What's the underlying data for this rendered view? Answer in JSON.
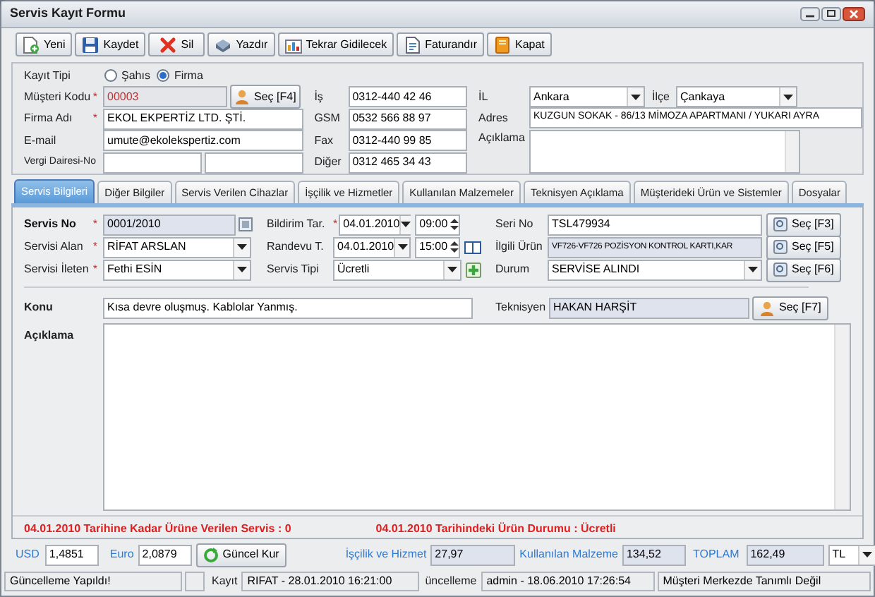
{
  "window": {
    "title": "Servis Kayıt Formu"
  },
  "toolbar": [
    {
      "kind": "new",
      "label": "Yeni"
    },
    {
      "kind": "save",
      "label": "Kaydet"
    },
    {
      "kind": "delete",
      "label": "Sil"
    },
    {
      "kind": "print",
      "label": "Yazdır"
    },
    {
      "kind": "repeat",
      "label": "Tekrar Gidilecek"
    },
    {
      "kind": "invoice",
      "label": "Faturandır"
    },
    {
      "kind": "close",
      "label": "Kapat"
    }
  ],
  "customer": {
    "record_type": {
      "label": "Kayıt Tipi",
      "options": [
        {
          "label": "Şahıs",
          "selected": false
        },
        {
          "label": "Firma",
          "selected": true
        }
      ]
    },
    "customer_code": {
      "label": "Müşteri Kodu",
      "required_mark": "*",
      "value": "00003",
      "button": "Seç [F4]"
    },
    "company": {
      "label": "Firma Adı",
      "required_mark": "*",
      "value": "EKOL EKPERTİZ LTD. ŞTİ."
    },
    "email": {
      "label": "E-mail",
      "value": "umute@ekolekspertiz.com"
    },
    "tax": {
      "label": "Vergi Dairesi-No"
    },
    "phones": [
      {
        "label": "İş",
        "value": "0312-440 42 46"
      },
      {
        "label": "GSM",
        "value": "0532 566 88 97"
      },
      {
        "label": "Fax",
        "value": "0312-440 99 85"
      },
      {
        "label": "Diğer",
        "value": "0312 465 34 43"
      }
    ],
    "city": {
      "label": "İL",
      "value": "Ankara"
    },
    "district": {
      "label": "İlçe",
      "value": "Çankaya"
    },
    "address": {
      "label": "Adres",
      "value": "KUZGUN SOKAK - 86/13  MİMOZA APARTMANI / YUKARI AYRA"
    },
    "note": {
      "label": "Açıklama"
    }
  },
  "tabs": [
    {
      "label": "Servis Bilgileri",
      "selected": true
    },
    {
      "label": "Diğer Bilgiler",
      "selected": false
    },
    {
      "label": "Servis Verilen Cihazlar",
      "selected": false
    },
    {
      "label": "İşçilik ve Hizmetler",
      "selected": false
    },
    {
      "label": "Kullanılan Malzemeler",
      "selected": false
    },
    {
      "label": "Teknisyen Açıklama",
      "selected": false
    },
    {
      "label": "Müşterideki Ürün ve Sistemler",
      "selected": false
    },
    {
      "label": "Dosyalar",
      "selected": false
    }
  ],
  "service": {
    "service_no": {
      "label": "Servis No",
      "required_mark": "*",
      "value": "0001/2010"
    },
    "received_by": {
      "label": "Servisi Alan",
      "required_mark": "*",
      "value": "RİFAT ARSLAN"
    },
    "forwarded_by": {
      "label": "Servisi İleten",
      "required_mark": "*",
      "value": "Fethi ESİN"
    },
    "notice_date": {
      "label": "Bildirim Tar.",
      "required_mark": "*",
      "date": "04.01.2010",
      "time": "09:00"
    },
    "appointment": {
      "label": "Randevu T.",
      "date": "04.01.2010",
      "time": "15:00"
    },
    "service_type": {
      "label": "Servis Tipi",
      "value": "Ücretli"
    },
    "serial": {
      "label": "Seri No",
      "value": "TSL479934",
      "button": "Seç [F3]"
    },
    "product": {
      "label": "İlgili Ürün",
      "value": "VF726-VF726 POZİSYON KONTROL KARTI,KAR",
      "button": "Seç [F5]"
    },
    "status": {
      "label": "Durum",
      "value": "SERVİSE ALINDI",
      "button": "Seç [F6]"
    },
    "subject": {
      "label": "Konu",
      "value": "Kısa devre oluşmuş. Kablolar Yanmış."
    },
    "technician": {
      "label": "Teknisyen",
      "value": "HAKAN HARŞİT",
      "button": "Seç [F7]"
    },
    "description": {
      "label": "Açıklama"
    },
    "notes": [
      "04.01.2010 Tarihine Kadar Ürüne Verilen Servis : 0",
      "04.01.2010 Tarihindeki Ürün Durumu : Ücretli"
    ]
  },
  "totals": {
    "usd": {
      "label": "USD",
      "value": "1,4851"
    },
    "euro": {
      "label": "Euro",
      "value": "2,0879"
    },
    "rate_button": "Güncel Kur",
    "labor": {
      "label": "İşçilik ve Hizmet",
      "value": "27,97"
    },
    "materials": {
      "label": "Kullanılan Malzeme",
      "value": "134,52"
    },
    "total": {
      "label": "TOPLAM",
      "value": "162,49"
    },
    "currency": "TL"
  },
  "status_bar": {
    "message": "Güncelleme Yapıldı!",
    "created_label": "Kayıt",
    "created": "RIFAT - 28.01.2010 16:21:00",
    "updated_label": "üncelleme",
    "updated": "admin - 18.06.2010 17:26:54",
    "customer_center": "Müşteri Merkezde Tanımlı Değil"
  }
}
